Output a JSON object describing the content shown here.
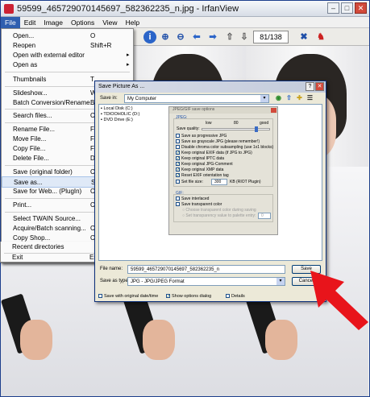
{
  "window": {
    "title": "59599_465729070145697_582362235_n.jpg - IrfanView",
    "min": "–",
    "max": "□",
    "close": "✕"
  },
  "menubar": {
    "items": [
      "File",
      "Edit",
      "Image",
      "Options",
      "View",
      "Help"
    ],
    "active": "File"
  },
  "toolbar": {
    "page_counter": "81/138"
  },
  "file_menu": {
    "items": [
      {
        "label": "Open...",
        "key": "O"
      },
      {
        "label": "Reopen",
        "key": "Shift+R"
      },
      {
        "label": "Open with external editor",
        "key": "▸"
      },
      {
        "label": "Open as",
        "key": "▸"
      },
      {
        "label": "Thumbnails",
        "key": "T"
      },
      {
        "label": "Slideshow...",
        "key": "W"
      },
      {
        "label": "Batch Conversion/Rename...",
        "key": "B"
      },
      {
        "label": "Search files...",
        "key": "Ctrl+F"
      },
      {
        "label": "Rename File...",
        "key": "F2"
      },
      {
        "label": "Move File...",
        "key": "F7"
      },
      {
        "label": "Copy File...",
        "key": "F8"
      },
      {
        "label": "Delete File...",
        "key": "Del"
      },
      {
        "label": "Save (original folder)",
        "key": "Ctrl+S"
      },
      {
        "label": "Save as...",
        "key": "S"
      },
      {
        "label": "Save for Web... (PlugIn)",
        "key": "Ctrl+Alt+S"
      },
      {
        "label": "Print...",
        "key": "Ctrl+P"
      },
      {
        "label": "Select TWAIN Source...",
        "key": ""
      },
      {
        "label": "Acquire/Batch scanning...",
        "key": "Ctrl+Shift+A"
      },
      {
        "label": "Copy Shop...",
        "key": "Ctrl+Shift+C"
      },
      {
        "label": "Recent directories",
        "key": "▸"
      },
      {
        "label": "Exit",
        "key": "Esc"
      }
    ]
  },
  "dialog": {
    "title": "Save Picture As ...",
    "save_in_label": "Save in:",
    "save_in_value": "My Computer",
    "drives": [
      "Local Disk (C:)",
      "TDIOOHOLIC (D:)",
      "DVD Drive (E:)"
    ],
    "filename_label": "File name:",
    "filename_value": "59599_465729070145697_582362235_n",
    "type_label": "Save as type:",
    "type_value": "JPG - JPG/JPEG Format",
    "save_button": "Save",
    "cancel_button": "Cancel",
    "opt_original_date": "Save with original date/time",
    "opt_show_options": "Show options dialog",
    "opt_details": "Details"
  },
  "jpeg_options": {
    "title": "JPEG/GIF save options",
    "jpeg_label": "JPEG:",
    "quality_label": "Save quality:",
    "q_low": "low",
    "q_value": "80",
    "q_good": "good",
    "quality_fraction": 0.8,
    "checks": [
      {
        "label": "Save as progressive JPG",
        "checked": false
      },
      {
        "label": "Save as grayscale JPG (please remember!)",
        "checked": false
      },
      {
        "label": "Disable chroma color subsampling (use 1x1 blocks)",
        "checked": false
      },
      {
        "label": "Keep original EXIF data (if JPG to JPG)",
        "checked": true
      },
      {
        "label": "Keep original IPTC data",
        "checked": true
      },
      {
        "label": "Keep original JPG-Comment",
        "checked": true
      },
      {
        "label": "Keep original XMP data",
        "checked": true
      },
      {
        "label": "Reset EXIF orientation tag",
        "checked": true
      }
    ],
    "set_file_size_label": "Set file size:",
    "file_size_value": "300",
    "file_size_unit": "KB (RIOT Plugin)",
    "gif_label": "GIF:",
    "gif_checks": [
      {
        "label": "Save interlaced",
        "checked": false
      },
      {
        "label": "Save transparent color",
        "checked": false
      }
    ],
    "gif_radios": [
      "Choose transparent color during saving",
      "Set transparency value to palette entry:"
    ],
    "palette_value": "0"
  },
  "colors": {
    "accent": "#2f5fb0",
    "arrow": "#e8141b",
    "title_bar": "#d7dde6"
  }
}
